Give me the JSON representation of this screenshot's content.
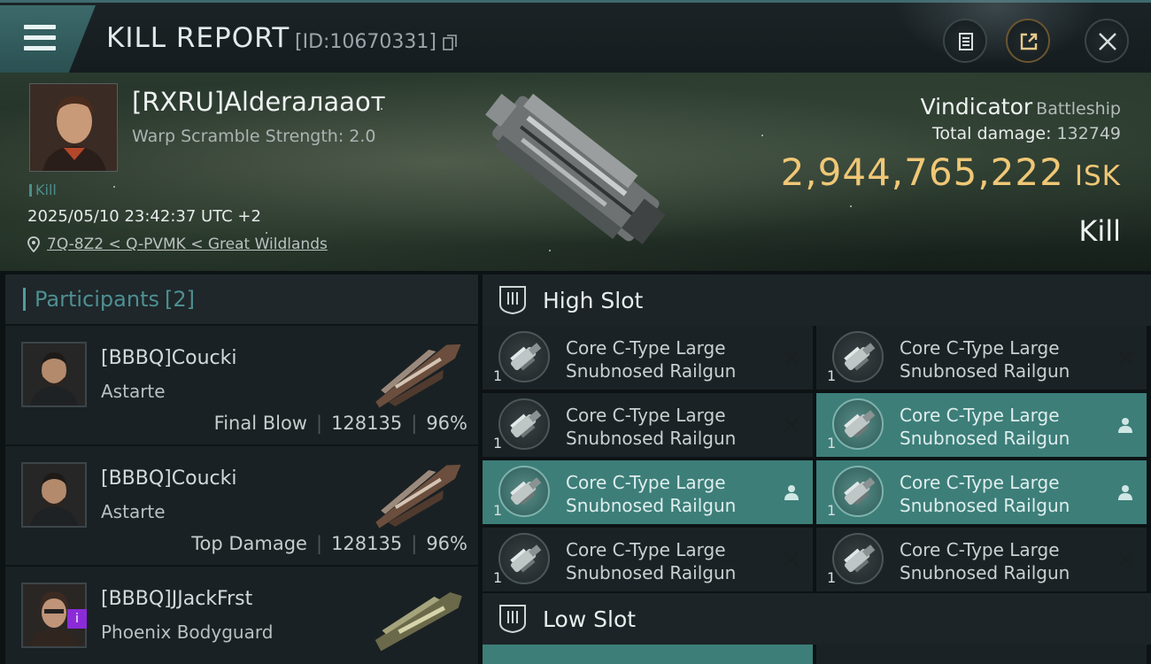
{
  "header": {
    "title": "KILL REPORT",
    "kill_id": "[ID:10670331]"
  },
  "victim": {
    "name": "[RXRU]Alderaлaaот",
    "warp_scramble": "Warp Scramble Strength: 2.0",
    "tag": "Kill",
    "datetime": "2025/05/10 23:42:37 UTC +2",
    "location": "7Q-8Z2 < Q-PVMK < Great Wildlands",
    "ship": "Vindicator",
    "ship_class": "Battleship",
    "damage_label": "Total damage:",
    "damage_value": "132749",
    "isk_value": "2,944,765,222",
    "isk_unit": "ISK",
    "result": "Kill"
  },
  "participants": {
    "title": "Participants",
    "count": "[2]",
    "rows": [
      {
        "name": "[BBBQ]Coucki",
        "ship": "Astarte",
        "role": "Final Blow",
        "damage": "128135",
        "percent": "96%"
      },
      {
        "name": "[BBBQ]Coucki",
        "ship": "Astarte",
        "role": "Top Damage",
        "damage": "128135",
        "percent": "96%"
      },
      {
        "name": "[BBBQ]JJackFrst",
        "ship": "Phoenix Bodyguard",
        "badge": "i"
      }
    ]
  },
  "slots": {
    "high_title": "High Slot",
    "low_title": "Low Slot",
    "high_modules": [
      {
        "line1": "Core C-Type Large",
        "line2": "Snubnosed Railgun",
        "qty": "1",
        "status": "destroyed"
      },
      {
        "line1": "Core C-Type Large",
        "line2": "Snubnosed Railgun",
        "qty": "1",
        "status": "destroyed"
      },
      {
        "line1": "Core C-Type Large",
        "line2": "Snubnosed Railgun",
        "qty": "1",
        "status": "destroyed"
      },
      {
        "line1": "Core C-Type Large",
        "line2": "Snubnosed Railgun",
        "qty": "1",
        "status": "dropped"
      },
      {
        "line1": "Core C-Type Large",
        "line2": "Snubnosed Railgun",
        "qty": "1",
        "status": "dropped"
      },
      {
        "line1": "Core C-Type Large",
        "line2": "Snubnosed Railgun",
        "qty": "1",
        "status": "dropped"
      },
      {
        "line1": "Core C-Type Large",
        "line2": "Snubnosed Railgun",
        "qty": "1",
        "status": "destroyed"
      },
      {
        "line1": "Core C-Type Large",
        "line2": "Snubnosed Railgun",
        "qty": "1",
        "status": "destroyed"
      }
    ]
  },
  "colors": {
    "accent": "#3d7e79",
    "isk": "#f0c776",
    "participants_title": "#4e8f92"
  }
}
